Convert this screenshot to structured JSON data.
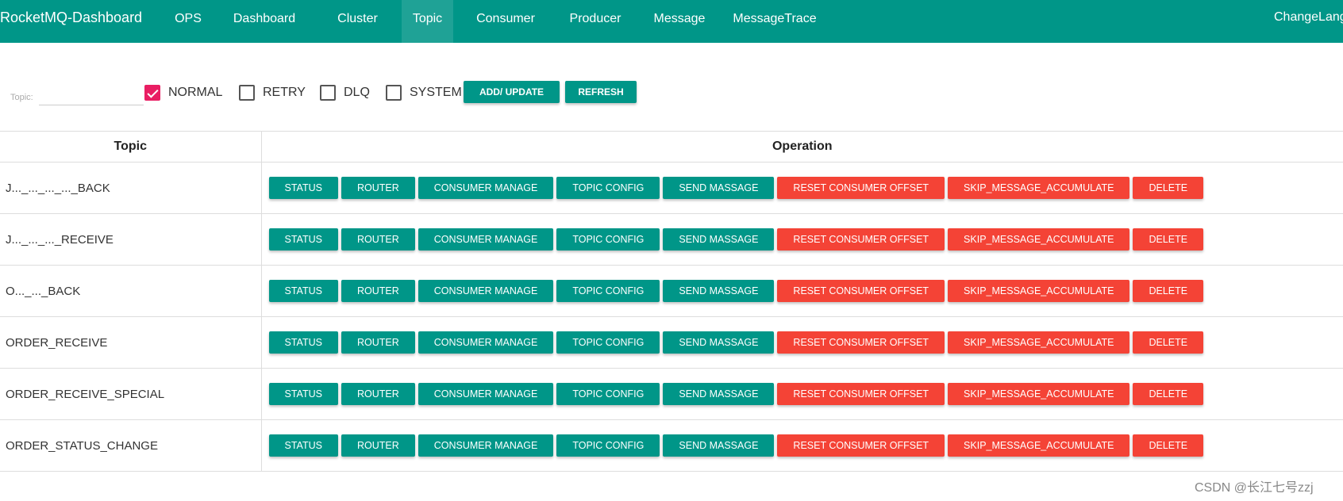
{
  "header": {
    "brand": "RocketMQ-Dashboard",
    "nav": [
      {
        "label": "OPS",
        "active": false
      },
      {
        "label": "Dashboard",
        "active": false
      },
      {
        "label": "Cluster",
        "active": false
      },
      {
        "label": "Topic",
        "active": true
      },
      {
        "label": "Consumer",
        "active": false
      },
      {
        "label": "Producer",
        "active": false
      },
      {
        "label": "Message",
        "active": false
      },
      {
        "label": "MessageTrace",
        "active": false
      }
    ],
    "change_lang": "ChangeLang"
  },
  "filter": {
    "topic_label": "Topic:",
    "topic_value": "",
    "checkboxes": [
      {
        "label": "NORMAL",
        "checked": true
      },
      {
        "label": "RETRY",
        "checked": false
      },
      {
        "label": "DLQ",
        "checked": false
      },
      {
        "label": "SYSTEM",
        "checked": false
      }
    ],
    "add_update_label": "ADD/ UPDATE",
    "refresh_label": "REFRESH"
  },
  "table": {
    "headers": {
      "topic": "Topic",
      "operation": "Operation"
    },
    "operations": [
      {
        "label": "STATUS",
        "color": "teal"
      },
      {
        "label": "ROUTER",
        "color": "teal"
      },
      {
        "label": "CONSUMER MANAGE",
        "color": "teal"
      },
      {
        "label": "TOPIC CONFIG",
        "color": "teal"
      },
      {
        "label": "SEND MASSAGE",
        "color": "teal"
      },
      {
        "label": "RESET CONSUMER OFFSET",
        "color": "red"
      },
      {
        "label": "SKIP_MESSAGE_ACCUMULATE",
        "color": "red"
      },
      {
        "label": "DELETE",
        "color": "red"
      }
    ],
    "rows": [
      {
        "topic": "J..._..._..._..._BACK"
      },
      {
        "topic": "J..._..._..._RECEIVE"
      },
      {
        "topic": "O..._..._BACK"
      },
      {
        "topic": "ORDER_RECEIVE"
      },
      {
        "topic": "ORDER_RECEIVE_SPECIAL"
      },
      {
        "topic": "ORDER_STATUS_CHANGE"
      }
    ]
  },
  "watermark": "CSDN @长江七号zzj",
  "colors": {
    "primary": "#009688",
    "danger": "#f44336",
    "checkbox_checked": "#e91e63"
  }
}
